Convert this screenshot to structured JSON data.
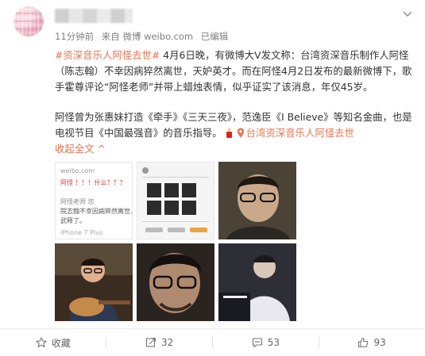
{
  "post": {
    "meta": {
      "time": "11分钟前",
      "source": "来自 微博 weibo.com",
      "edited": "已编辑"
    },
    "para1": {
      "topic": "#资深音乐人阿怪去世#",
      "text": " 4月6日晚，有微博大V发文称：台湾资深音乐制作人阿怪（陈志翰）不幸因病猝然离世，天妒英才。而在阿怪4月2日发布的最新微博下，歌手霍尊评论“阿怪老师”并带上蜡烛表情，似乎证实了该消息，年仅45岁。"
    },
    "para2": {
      "text": "阿怪曾为张惠妹打造《牵手》《三天三夜》，范逸臣《I Believe》等知名金曲，也是电视节目《中国最强音》的音乐指导。",
      "location": "台湾资深音乐人阿怪去世",
      "fold": "收起全文",
      "fold_arrow": "^"
    },
    "thumb1": {
      "lines": [
        "weibo.com",
        "阿怪 ！！！什么？？？",
        "",
        "",
        "",
        "阿怪老师 您",
        "院志翰不幸因病猝然离世，真是天妒英才。",
        "武释了。",
        "",
        "iPhone 7 Plus"
      ]
    }
  },
  "footer": {
    "favorite": "收藏",
    "repost": "32",
    "comment": "53",
    "like": "93"
  },
  "icons": [
    "avatar",
    "chevron-down-icon",
    "candle-icon",
    "location-icon",
    "star-icon",
    "repost-icon",
    "comment-icon",
    "like-icon"
  ]
}
